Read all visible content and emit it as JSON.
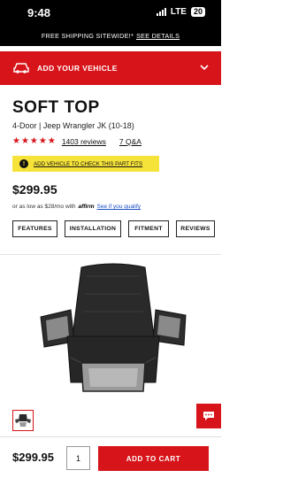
{
  "status_bar": {
    "time": "9:48",
    "network": "LTE",
    "battery": "20"
  },
  "promo": {
    "text": "FREE SHIPPING SITEWIDE!*",
    "link": "SEE DETAILS"
  },
  "vehicle_bar": {
    "label": "ADD YOUR VEHICLE",
    "icon": "car-icon"
  },
  "product": {
    "title": "SOFT TOP",
    "subtitle": "4-Door | Jeep Wrangler JK (10-18)",
    "stars": "★★★★★",
    "rating_out_of_5": 5,
    "reviews": "1403 reviews",
    "qa": "7 Q&A",
    "fit_banner": "ADD VEHICLE TO CHECK THIS PART FITS",
    "price": "$299.95",
    "financing_prefix": "or as low as $28/mo with",
    "financing_brand": "affirm",
    "financing_link": "See if you qualify"
  },
  "tabs": [
    "FEATURES",
    "INSTALLATION",
    "FITMENT",
    "REVIEWS"
  ],
  "bottom_bar": {
    "price": "$299.95",
    "quantity": "1",
    "cta": "ADD TO CART"
  },
  "colors": {
    "brand_red": "#d7141a",
    "banner_yellow": "#f6e33a",
    "link_blue": "#1b4fc4"
  }
}
